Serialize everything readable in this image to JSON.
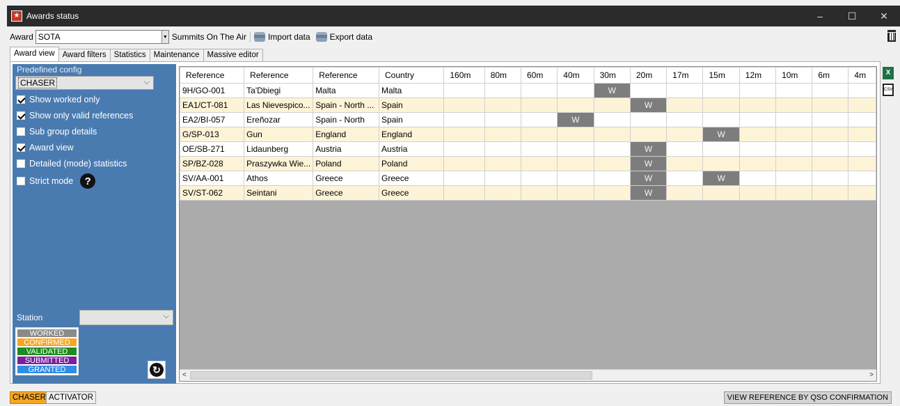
{
  "window": {
    "title": "Awards status",
    "minimize": "–",
    "maximize": "☐",
    "close": "✕"
  },
  "toolbar": {
    "award_label": "Award",
    "award_value": "SOTA",
    "award_desc": "Summits On The Air",
    "import_label": "Import data",
    "export_label": "Export data"
  },
  "tabs": [
    "Award view",
    "Award filters",
    "Statistics",
    "Maintenance",
    "Massive editor"
  ],
  "sidebar": {
    "predefined_label": "Predefined config",
    "predefined_value": "CHASER",
    "checkboxes": [
      {
        "label": "Show worked only",
        "checked": true
      },
      {
        "label": "Show only valid references",
        "checked": true
      },
      {
        "label": "Sub group details",
        "checked": false
      },
      {
        "label": "Award view",
        "checked": true
      },
      {
        "label": "Detailed (mode) statistics",
        "checked": false
      },
      {
        "label": "Strict mode",
        "checked": false
      }
    ],
    "help_icon": "?",
    "station_label": "Station",
    "station_value": "",
    "legend": [
      {
        "label": "WORKED",
        "color": "#8a8a8a"
      },
      {
        "label": "CONFIRMED",
        "color": "#f5a623"
      },
      {
        "label": "VALIDATED",
        "color": "#1e8b1e"
      },
      {
        "label": "SUBMITTED",
        "color": "#7a1fa2"
      },
      {
        "label": "GRANTED",
        "color": "#2e8be6"
      }
    ]
  },
  "grid": {
    "columns": [
      "Reference",
      "Reference",
      "Reference",
      "Country",
      "160m",
      "80m",
      "60m",
      "40m",
      "30m",
      "20m",
      "17m",
      "15m",
      "12m",
      "10m",
      "6m",
      "4m"
    ],
    "rows": [
      {
        "cells": [
          "9H/GO-001",
          "Ta'Dbiegi",
          "Malta",
          "Malta"
        ],
        "bands": {
          "30m": "W"
        }
      },
      {
        "cells": [
          "EA1/CT-081",
          "Las Nievespico...",
          "Spain - North ...",
          "Spain"
        ],
        "bands": {
          "20m": "W"
        }
      },
      {
        "cells": [
          "EA2/BI-057",
          "Ereñozar",
          "Spain - North",
          "Spain"
        ],
        "bands": {
          "40m": "W"
        }
      },
      {
        "cells": [
          "G/SP-013",
          "Gun",
          "England",
          "England"
        ],
        "bands": {
          "15m": "W"
        }
      },
      {
        "cells": [
          "OE/SB-271",
          "Lidaunberg",
          "Austria",
          "Austria"
        ],
        "bands": {
          "20m": "W"
        }
      },
      {
        "cells": [
          "SP/BZ-028",
          "Praszywka Wie...",
          "Poland",
          "Poland"
        ],
        "bands": {
          "20m": "W"
        }
      },
      {
        "cells": [
          "SV/AA-001",
          "Athos",
          "Greece",
          "Greece"
        ],
        "bands": {
          "20m": "W",
          "15m": "W"
        }
      },
      {
        "cells": [
          "SV/ST-062",
          "Seintani",
          "Greece",
          "Greece"
        ],
        "bands": {
          "20m": "W"
        }
      }
    ]
  },
  "side_icons": {
    "excel": "X",
    "csv": "CSV"
  },
  "statusbar": {
    "chaser": "CHASER",
    "activator": "ACTIVATOR",
    "view_ref": "VIEW REFERENCE BY QSO CONFIRMATION"
  }
}
